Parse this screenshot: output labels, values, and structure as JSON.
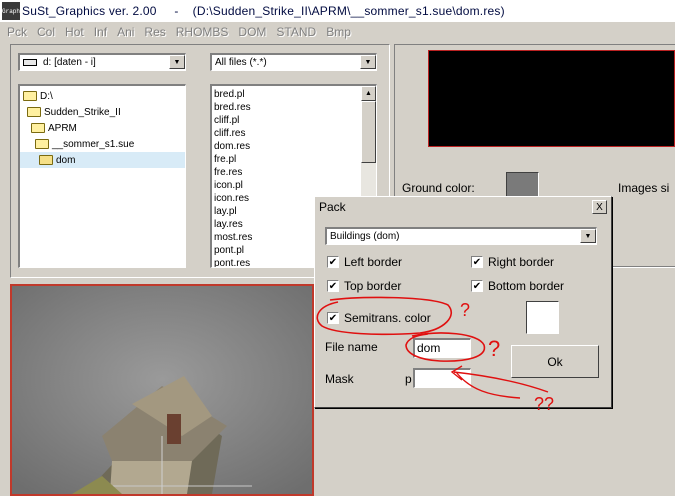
{
  "window": {
    "icon_text": "Graph",
    "title": "SuSt_Graphics ver. 2.00     -    (D:\\Sudden_Strike_II\\APRM\\__sommer_s1.sue\\dom.res)"
  },
  "menu": [
    "Pck",
    "Col",
    "Hot",
    "Inf",
    "Ani",
    "Res",
    "RHOMBS",
    "DOM",
    "STAND",
    "Bmp"
  ],
  "drive_combo": {
    "value": "d: [daten - i]"
  },
  "filter_combo": {
    "value": "All files (*.*)"
  },
  "tree": [
    {
      "label": "D:\\",
      "indent": 0
    },
    {
      "label": "Sudden_Strike_II",
      "indent": 1
    },
    {
      "label": "APRM",
      "indent": 2
    },
    {
      "label": "__sommer_s1.sue",
      "indent": 3
    },
    {
      "label": "dom",
      "indent": 4
    }
  ],
  "files": [
    "bred.pl",
    "bred.res",
    "cliff.pl",
    "cliff.res",
    "dom.res",
    "fre.pl",
    "fre.res",
    "icon.pl",
    "icon.res",
    "lay.pl",
    "lay.res",
    "most.res",
    "pont.pl",
    "pont.res"
  ],
  "right_panel": {
    "ground_color_label": "Ground color:",
    "images_label": "Images si"
  },
  "preview": {
    "index": "1"
  },
  "dialog": {
    "title": "Pack",
    "close": "X",
    "type_combo": "Buildings (dom)",
    "left_border": "Left border",
    "right_border": "Right border",
    "top_border": "Top border",
    "bottom_border": "Bottom border",
    "semitrans": "Semitrans. color",
    "filename_label": "File name",
    "filename_value": "dom",
    "mask_label": "Mask",
    "mask_prefix": "p",
    "mask_value": "",
    "ok": "Ok"
  },
  "annotations": {
    "q1": "?",
    "q2": "?",
    "q3": "??"
  },
  "colors": {
    "annotation_red": "#e01010",
    "preview_border": "#c0392b",
    "black_panel": "#000000",
    "ground_swatch": "#7a7a7a"
  }
}
